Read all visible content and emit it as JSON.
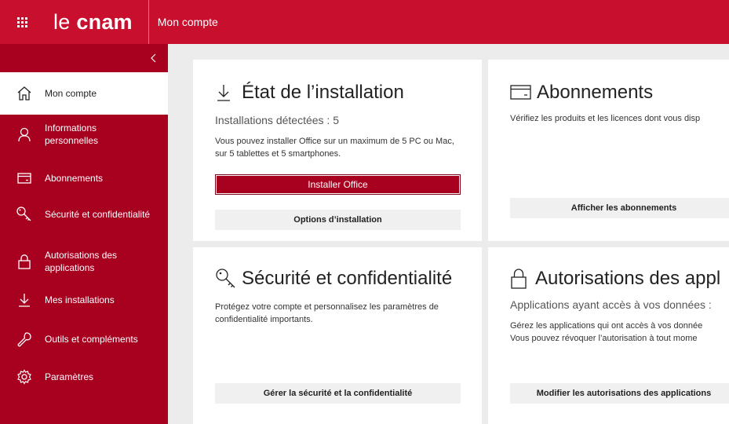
{
  "header": {
    "brand_part1": "le",
    "brand_part2": "cnam",
    "app_title": "Mon compte"
  },
  "sidebar": {
    "collapse_glyph": "‹",
    "items": [
      {
        "label": "Mon compte",
        "icon": "home-icon",
        "active": true
      },
      {
        "label": "Informations personnelles",
        "icon": "person-icon"
      },
      {
        "label": "Abonnements",
        "icon": "card-icon"
      },
      {
        "label": "Sécurité et confidentialité",
        "icon": "key-icon"
      },
      {
        "label": "Autorisations des applications",
        "icon": "lock-icon"
      },
      {
        "label": "Mes installations",
        "icon": "download-icon"
      },
      {
        "label": "Outils et compléments",
        "icon": "wrench-icon"
      },
      {
        "label": "Paramètres",
        "icon": "gear-icon"
      }
    ]
  },
  "cards": {
    "install": {
      "title": "État de l’installation",
      "subtitle": "Installations détectées : 5",
      "desc": "Vous pouvez installer Office sur un maximum de 5 PC ou Mac, sur 5 tablettes et 5 smartphones.",
      "primary_button": "Installer Office",
      "secondary_button": "Options d’installation"
    },
    "subscriptions": {
      "title": "Abonnements",
      "desc": "Vérifiez les produits et les licences dont vous disp",
      "button": "Afficher les abonnements"
    },
    "security": {
      "title": "Sécurité et confidentialité",
      "desc": "Protégez votre compte et personnalisez les paramètres de confidentialité importants.",
      "button": "Gérer la sécurité et la confidentialité"
    },
    "permissions": {
      "title": "Autorisations des appl",
      "subtitle": "Applications ayant accès à vos données :",
      "desc_line1": "Gérez les applications qui ont accès à vos donnée",
      "desc_line2": "Vous pouvez révoquer l’autorisation à tout mome",
      "button": "Modifier les autorisations des applications"
    }
  },
  "colors": {
    "brand_red": "#c8102e",
    "sidebar_red": "#a8001f",
    "background": "#ececec"
  }
}
